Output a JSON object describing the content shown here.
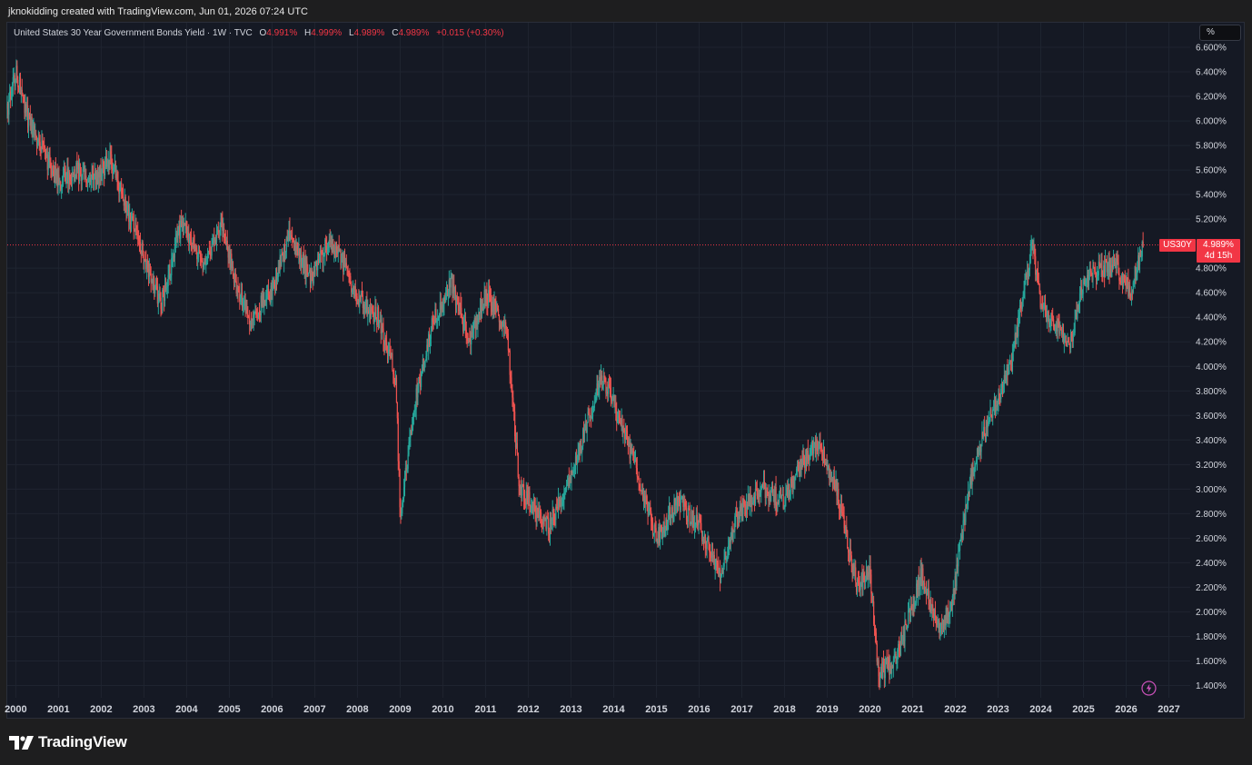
{
  "header": {
    "credit": "jknokidding created with TradingView.com, Jun 01, 2026 07:24 UTC"
  },
  "legend": {
    "symbol_line": "United States 30 Year Government Bonds Yield · 1W · TVC",
    "open_label": "O",
    "open_value": "4.991%",
    "high_label": "H",
    "high_value": "4.999%",
    "low_label": "L",
    "low_value": "4.989%",
    "close_label": "C",
    "close_value": "4.989%",
    "change": "+0.015 (+0.30%)"
  },
  "unit_button": "%",
  "price_tag": {
    "symbol": "US30Y",
    "value": "4.989%",
    "countdown": "4d 15h"
  },
  "footer": {
    "brand": "TradingView"
  },
  "icons": {
    "logo": "tradingview-logo-icon",
    "bolt": "lightning-bolt-icon"
  },
  "colors": {
    "background": "#151924",
    "up": "#26a69a",
    "down": "#ef5350",
    "price_line": "#f23645",
    "grid": "#1f2430",
    "axis_text": "#d1d4dc"
  },
  "chart_data": {
    "type": "candlestick",
    "title": "United States 30 Year Government Bonds Yield · 1W · TVC",
    "timeframe": "1W",
    "x_range": [
      1999.8,
      2027.5
    ],
    "ylim": [
      1.3,
      6.8
    ],
    "y_unit": "%",
    "grid": true,
    "x_ticks": [
      2000,
      2001,
      2002,
      2003,
      2004,
      2005,
      2006,
      2007,
      2008,
      2009,
      2010,
      2011,
      2012,
      2013,
      2014,
      2015,
      2016,
      2017,
      2018,
      2019,
      2020,
      2021,
      2022,
      2023,
      2024,
      2025,
      2026,
      2027
    ],
    "x_tick_labels": [
      "2000",
      "2001",
      "2002",
      "2003",
      "2004",
      "2005",
      "2006",
      "2007",
      "2008",
      "2009",
      "2010",
      "2011",
      "2012",
      "2013",
      "2014",
      "2015",
      "2016",
      "2017",
      "2018",
      "2019",
      "2020",
      "2021",
      "2022",
      "2023",
      "2024",
      "2025",
      "2026",
      "2027"
    ],
    "y_ticks": [
      1.4,
      1.6,
      1.8,
      2.0,
      2.2,
      2.4,
      2.6,
      2.8,
      3.0,
      3.2,
      3.4,
      3.6,
      3.8,
      4.0,
      4.2,
      4.4,
      4.6,
      4.8,
      5.2,
      5.4,
      5.6,
      5.8,
      6.0,
      6.2,
      6.4,
      6.6
    ],
    "y_tick_labels": [
      "1.400%",
      "1.600%",
      "1.800%",
      "2.000%",
      "2.200%",
      "2.400%",
      "2.600%",
      "2.800%",
      "3.000%",
      "3.200%",
      "3.400%",
      "3.600%",
      "3.800%",
      "4.000%",
      "4.200%",
      "4.400%",
      "4.600%",
      "4.800%",
      "5.200%",
      "5.400%",
      "5.600%",
      "5.800%",
      "6.000%",
      "6.200%",
      "6.400%",
      "6.600%"
    ],
    "last_price": 4.989,
    "path_x": [
      1999.8,
      2000.0,
      2000.3,
      2000.7,
      2001.0,
      2001.4,
      2001.8,
      2002.2,
      2002.7,
      2003.0,
      2003.4,
      2003.9,
      2004.4,
      2004.8,
      2005.2,
      2005.5,
      2006.0,
      2006.4,
      2006.9,
      2007.3,
      2007.6,
      2007.9,
      2008.5,
      2008.9,
      2009.0,
      2009.4,
      2009.8,
      2010.2,
      2010.6,
      2011.0,
      2011.5,
      2011.8,
      2012.5,
      2013.0,
      2013.7,
      2014.0,
      2014.5,
      2015.0,
      2015.5,
      2016.0,
      2016.5,
      2016.9,
      2017.5,
      2018.0,
      2018.4,
      2018.8,
      2019.2,
      2019.7,
      2020.0,
      2020.2,
      2020.6,
      2021.2,
      2021.6,
      2021.9,
      2022.3,
      2022.8,
      2023.3,
      2023.8,
      2024.0,
      2024.7,
      2025.0,
      2025.4,
      2025.8,
      2026.1,
      2026.4
    ],
    "path_y": [
      6.1,
      6.4,
      6.0,
      5.7,
      5.5,
      5.6,
      5.5,
      5.7,
      5.2,
      4.9,
      4.5,
      5.2,
      4.8,
      5.2,
      4.6,
      4.4,
      4.6,
      5.1,
      4.7,
      5.0,
      4.9,
      4.6,
      4.4,
      3.9,
      2.8,
      3.8,
      4.4,
      4.7,
      4.2,
      4.6,
      4.3,
      3.0,
      2.7,
      3.1,
      3.9,
      3.7,
      3.2,
      2.6,
      2.9,
      2.7,
      2.3,
      2.8,
      3.0,
      2.9,
      3.2,
      3.4,
      3.0,
      2.2,
      2.3,
      1.5,
      1.6,
      2.3,
      1.9,
      2.0,
      3.0,
      3.6,
      4.0,
      5.0,
      4.5,
      4.2,
      4.7,
      4.8,
      4.8,
      4.6,
      5.0
    ]
  }
}
